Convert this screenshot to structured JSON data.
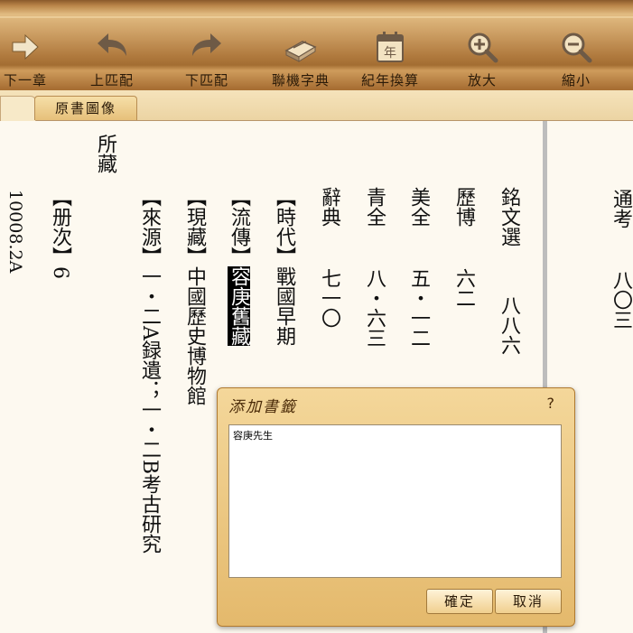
{
  "toolbar": {
    "buttons": [
      {
        "id": "next-chapter",
        "label": "下一章",
        "icon": "arrow-right-icon"
      },
      {
        "id": "prev-match",
        "label": "上匹配",
        "icon": "undo-arrow-icon"
      },
      {
        "id": "next-match",
        "label": "下匹配",
        "icon": "redo-arrow-icon"
      },
      {
        "id": "dictionary",
        "label": "聯機字典",
        "icon": "book-icon"
      },
      {
        "id": "year-convert",
        "label": "紀年換算",
        "icon": "calendar-icon"
      },
      {
        "id": "zoom-in",
        "label": "放大",
        "icon": "zoom-in-icon"
      },
      {
        "id": "zoom-out",
        "label": "縮小",
        "icon": "zoom-out-icon"
      }
    ]
  },
  "tabs": {
    "active": "原書圖像"
  },
  "content": {
    "right_col": {
      "c1": "通考",
      "c2": "八〇三"
    },
    "columns": [
      {
        "top": "銘文選",
        "bottom": "八八六"
      },
      {
        "top": "歷博",
        "bottom": "六二"
      },
      {
        "top": "美全",
        "bottom": "五・一二"
      },
      {
        "top": "青全",
        "bottom": "八・六三"
      },
      {
        "top": "辭典",
        "bottom": "七一〇"
      }
    ],
    "fields": {
      "era_label": "【時代】",
      "era_value": "戰國早期",
      "hist_label": "【流傳】",
      "hist_value": "容庚舊藏",
      "loc_label": "【現藏】",
      "loc_value": "中國歷史博物館",
      "src_label": "【來源】",
      "src_value": "一・二A録遺；一・二B考古研究",
      "vol_label": "【册次】",
      "vol_value": "6"
    },
    "cont": "所藏",
    "number": "10008.2A"
  },
  "dialog": {
    "title": "添加書籤",
    "help": "?",
    "text": "容庚先生",
    "ok": "確定",
    "cancel": "取消"
  },
  "colors": {
    "toolbar": "#c99a5f",
    "highlight": "#000000",
    "divider": "#bdbdbd"
  }
}
